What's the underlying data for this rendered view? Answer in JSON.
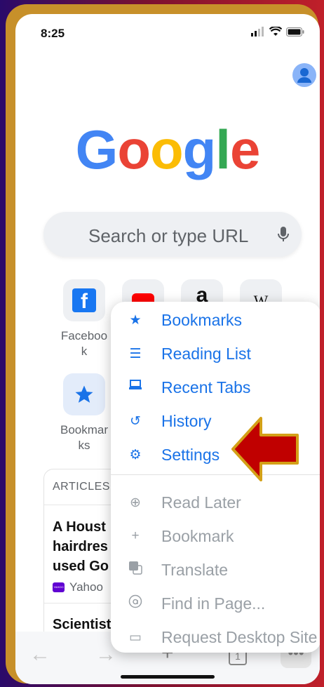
{
  "status_bar": {
    "time": "8:25"
  },
  "logo_letters": [
    {
      "ch": "G",
      "color": "#4285F4"
    },
    {
      "ch": "o",
      "color": "#EA4335"
    },
    {
      "ch": "o",
      "color": "#FBBC05"
    },
    {
      "ch": "g",
      "color": "#4285F4"
    },
    {
      "ch": "l",
      "color": "#34A853"
    },
    {
      "ch": "e",
      "color": "#EA4335"
    }
  ],
  "search": {
    "placeholder": "Search or type URL"
  },
  "shortcuts": {
    "facebook_icon_letter": "f",
    "amazon_icon_letter": "a",
    "wikipedia_icon_letter": "W",
    "facebook_label_line1": "Faceboo",
    "facebook_label_line2": "k",
    "bookmarks_label_line1": "Bookmar",
    "bookmarks_label_line2": "ks"
  },
  "feed": {
    "header": "ARTICLES",
    "headline_line1": "A Houst",
    "headline_line2": "hairdres",
    "headline_line3": "used Go",
    "source": "Yahoo",
    "source_badge": "YAHOO",
    "second_headline": "Scientist"
  },
  "menu": {
    "items": [
      {
        "label": "Bookmarks",
        "icon": "star-icon",
        "enabled": true
      },
      {
        "label": "Reading List",
        "icon": "list-icon",
        "enabled": true
      },
      {
        "label": "Recent Tabs",
        "icon": "devices-icon",
        "enabled": true
      },
      {
        "label": "History",
        "icon": "history-icon",
        "enabled": true
      },
      {
        "label": "Settings",
        "icon": "gear-icon",
        "enabled": true
      }
    ],
    "disabled_items": [
      {
        "label": "Read Later",
        "icon": "add-circle-icon",
        "enabled": false
      },
      {
        "label": "Bookmark",
        "icon": "plus-icon",
        "enabled": false
      },
      {
        "label": "Translate",
        "icon": "translate-icon",
        "enabled": false
      },
      {
        "label": "Find in Page...",
        "icon": "find-icon",
        "enabled": false
      },
      {
        "label": "Request Desktop Site",
        "icon": "desktop-icon",
        "enabled": false
      }
    ]
  },
  "toolbar": {
    "tab_count": "1"
  },
  "annotation": {
    "arrow_color": "#c00000",
    "arrow_border": "#d4a017"
  },
  "colors": {
    "accent": "#1a73e8",
    "disabled": "#9aa0a6"
  }
}
